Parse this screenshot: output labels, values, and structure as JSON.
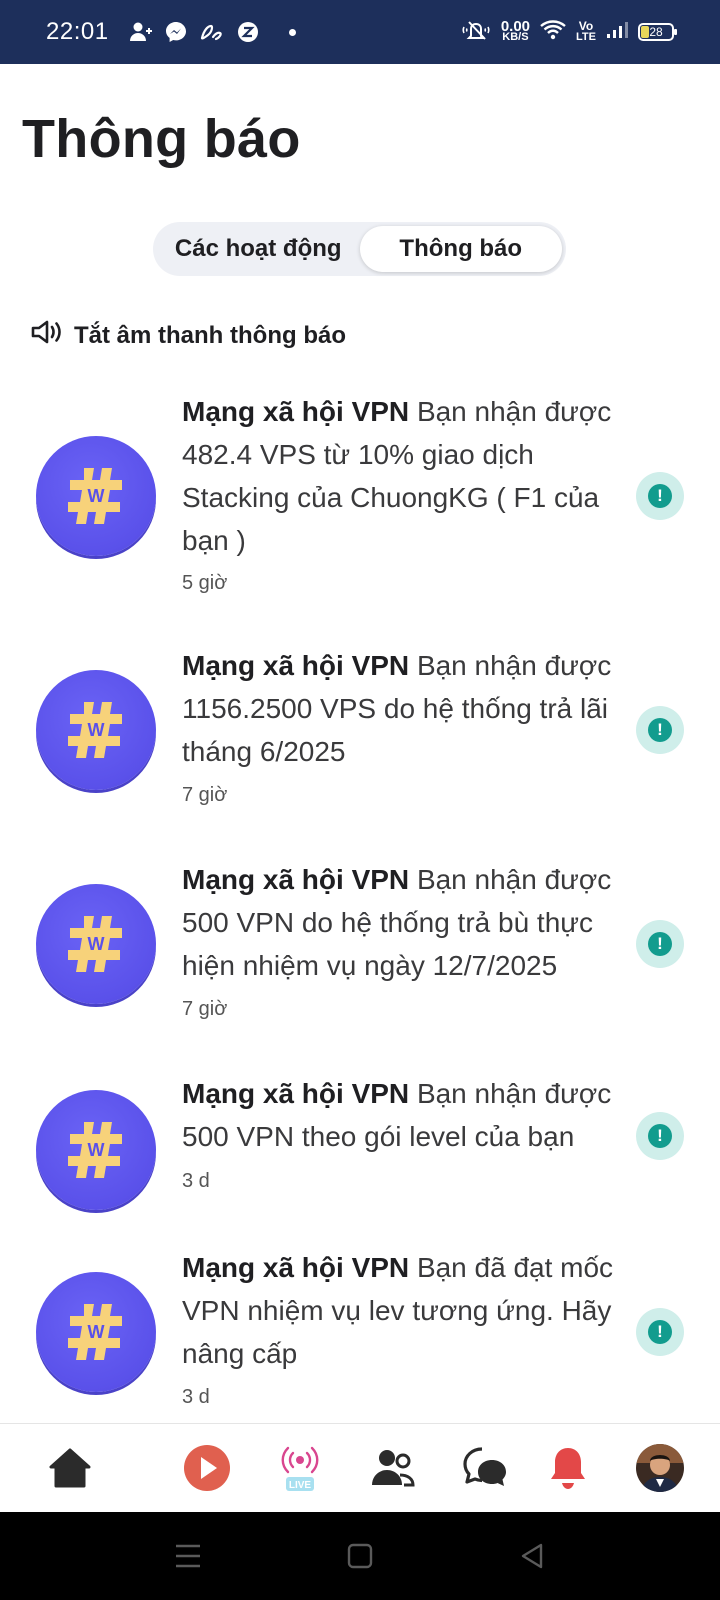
{
  "status_bar": {
    "time": "22:01",
    "net_speed_value": "0.00",
    "net_speed_unit": "KB/S",
    "volte_top": "Vo",
    "volte_bottom": "LTE",
    "battery": "28",
    "icons": [
      "add-contact-icon",
      "messenger-icon",
      "ab-app-icon",
      "zalo-icon",
      "mute-icon",
      "wifi-icon",
      "signal-icon",
      "battery-icon"
    ]
  },
  "page": {
    "title": "Thông báo"
  },
  "tabs": [
    {
      "label": "Các hoạt động",
      "active": false
    },
    {
      "label": "Thông báo",
      "active": true
    }
  ],
  "mute": {
    "label": "Tắt âm thanh thông báo",
    "icon": "speaker-icon"
  },
  "notifications": [
    {
      "sender": "Mạng xã hội VPN",
      "message": "Bạn nhận được 482.4 VPS từ 10% giao dịch Stacking của ChuongKG ( F1 của bạn )",
      "time": "5 giờ"
    },
    {
      "sender": "Mạng xã hội VPN",
      "message": "Bạn nhận được 1156.2500 VPS do hệ thống trả lãi tháng 6/2025",
      "time": "7 giờ"
    },
    {
      "sender": "Mạng xã hội VPN",
      "message": "Bạn nhận được 500 VPN do hệ thống trả bù thực hiện nhiệm vụ ngày 12/7/2025",
      "time": "7 giờ"
    },
    {
      "sender": "Mạng xã hội VPN",
      "message": "Bạn nhận được 500 VPN theo gói level của bạn",
      "time": "3 d"
    },
    {
      "sender": "Mạng xã hội VPN",
      "message": "Bạn đã đạt mốc VPN nhiệm vụ lev tương ứng. Hãy nâng cấp",
      "time": "3 d"
    }
  ],
  "bottom_nav": {
    "live_label": "LIVE",
    "items": [
      "home-icon",
      "play-icon",
      "live-icon",
      "friends-icon",
      "chat-icon",
      "bell-icon",
      "profile-avatar"
    ]
  },
  "colors": {
    "status_bar": "#1d2f5b",
    "avatar": "#5a51ea",
    "hash": "#f7d27a",
    "badge_bg": "#cfeeea",
    "badge_fg": "#129c8e",
    "play": "#e0604f",
    "bell": "#e34848",
    "live": "#d9468f"
  }
}
